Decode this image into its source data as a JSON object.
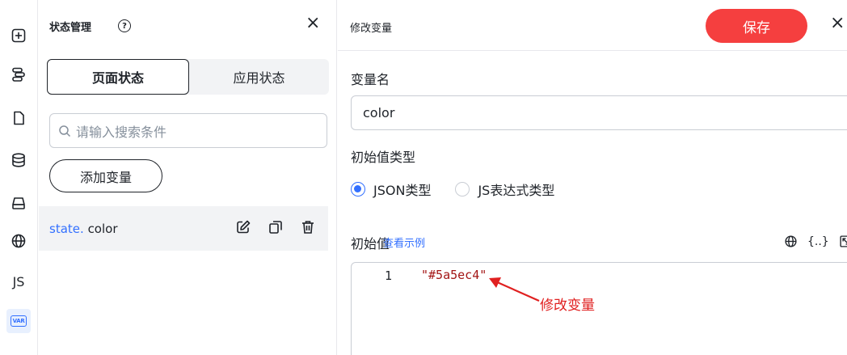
{
  "rail": {
    "items": [
      {
        "name": "add-page-icon"
      },
      {
        "name": "outline-icon"
      },
      {
        "name": "page-icon"
      },
      {
        "name": "database-icon"
      },
      {
        "name": "component-icon"
      },
      {
        "name": "globe-icon"
      },
      {
        "name": "js-icon",
        "label": "JS"
      },
      {
        "name": "variable-icon",
        "label": "VAR"
      }
    ]
  },
  "state_panel": {
    "title": "状态管理",
    "help": "?",
    "close": "×",
    "tabs": [
      {
        "label": "页面状态",
        "active": true
      },
      {
        "label": "应用状态",
        "active": false
      }
    ],
    "search_placeholder": "请输入搜索条件",
    "add_button": "添加变量",
    "variables": [
      {
        "prefix": "state.",
        "name": "color"
      }
    ]
  },
  "edit_panel": {
    "title": "修改变量",
    "save_label": "保存",
    "close": "×",
    "name_label": "变量名",
    "name_value": "color",
    "type_label": "初始值类型",
    "type_options": [
      {
        "label": "JSON类型",
        "checked": true
      },
      {
        "label": "JS表达式类型",
        "checked": false
      }
    ],
    "initial_label": "初始值",
    "example_link": "查看示例",
    "braces_icon": "{..}",
    "editor": {
      "line_number": "1",
      "code": "\"#5a5ec4\""
    },
    "annotation": "修改变量"
  },
  "colors": {
    "accent": "#3370ff",
    "save": "#f53f3f",
    "annotation": "#e02020"
  }
}
